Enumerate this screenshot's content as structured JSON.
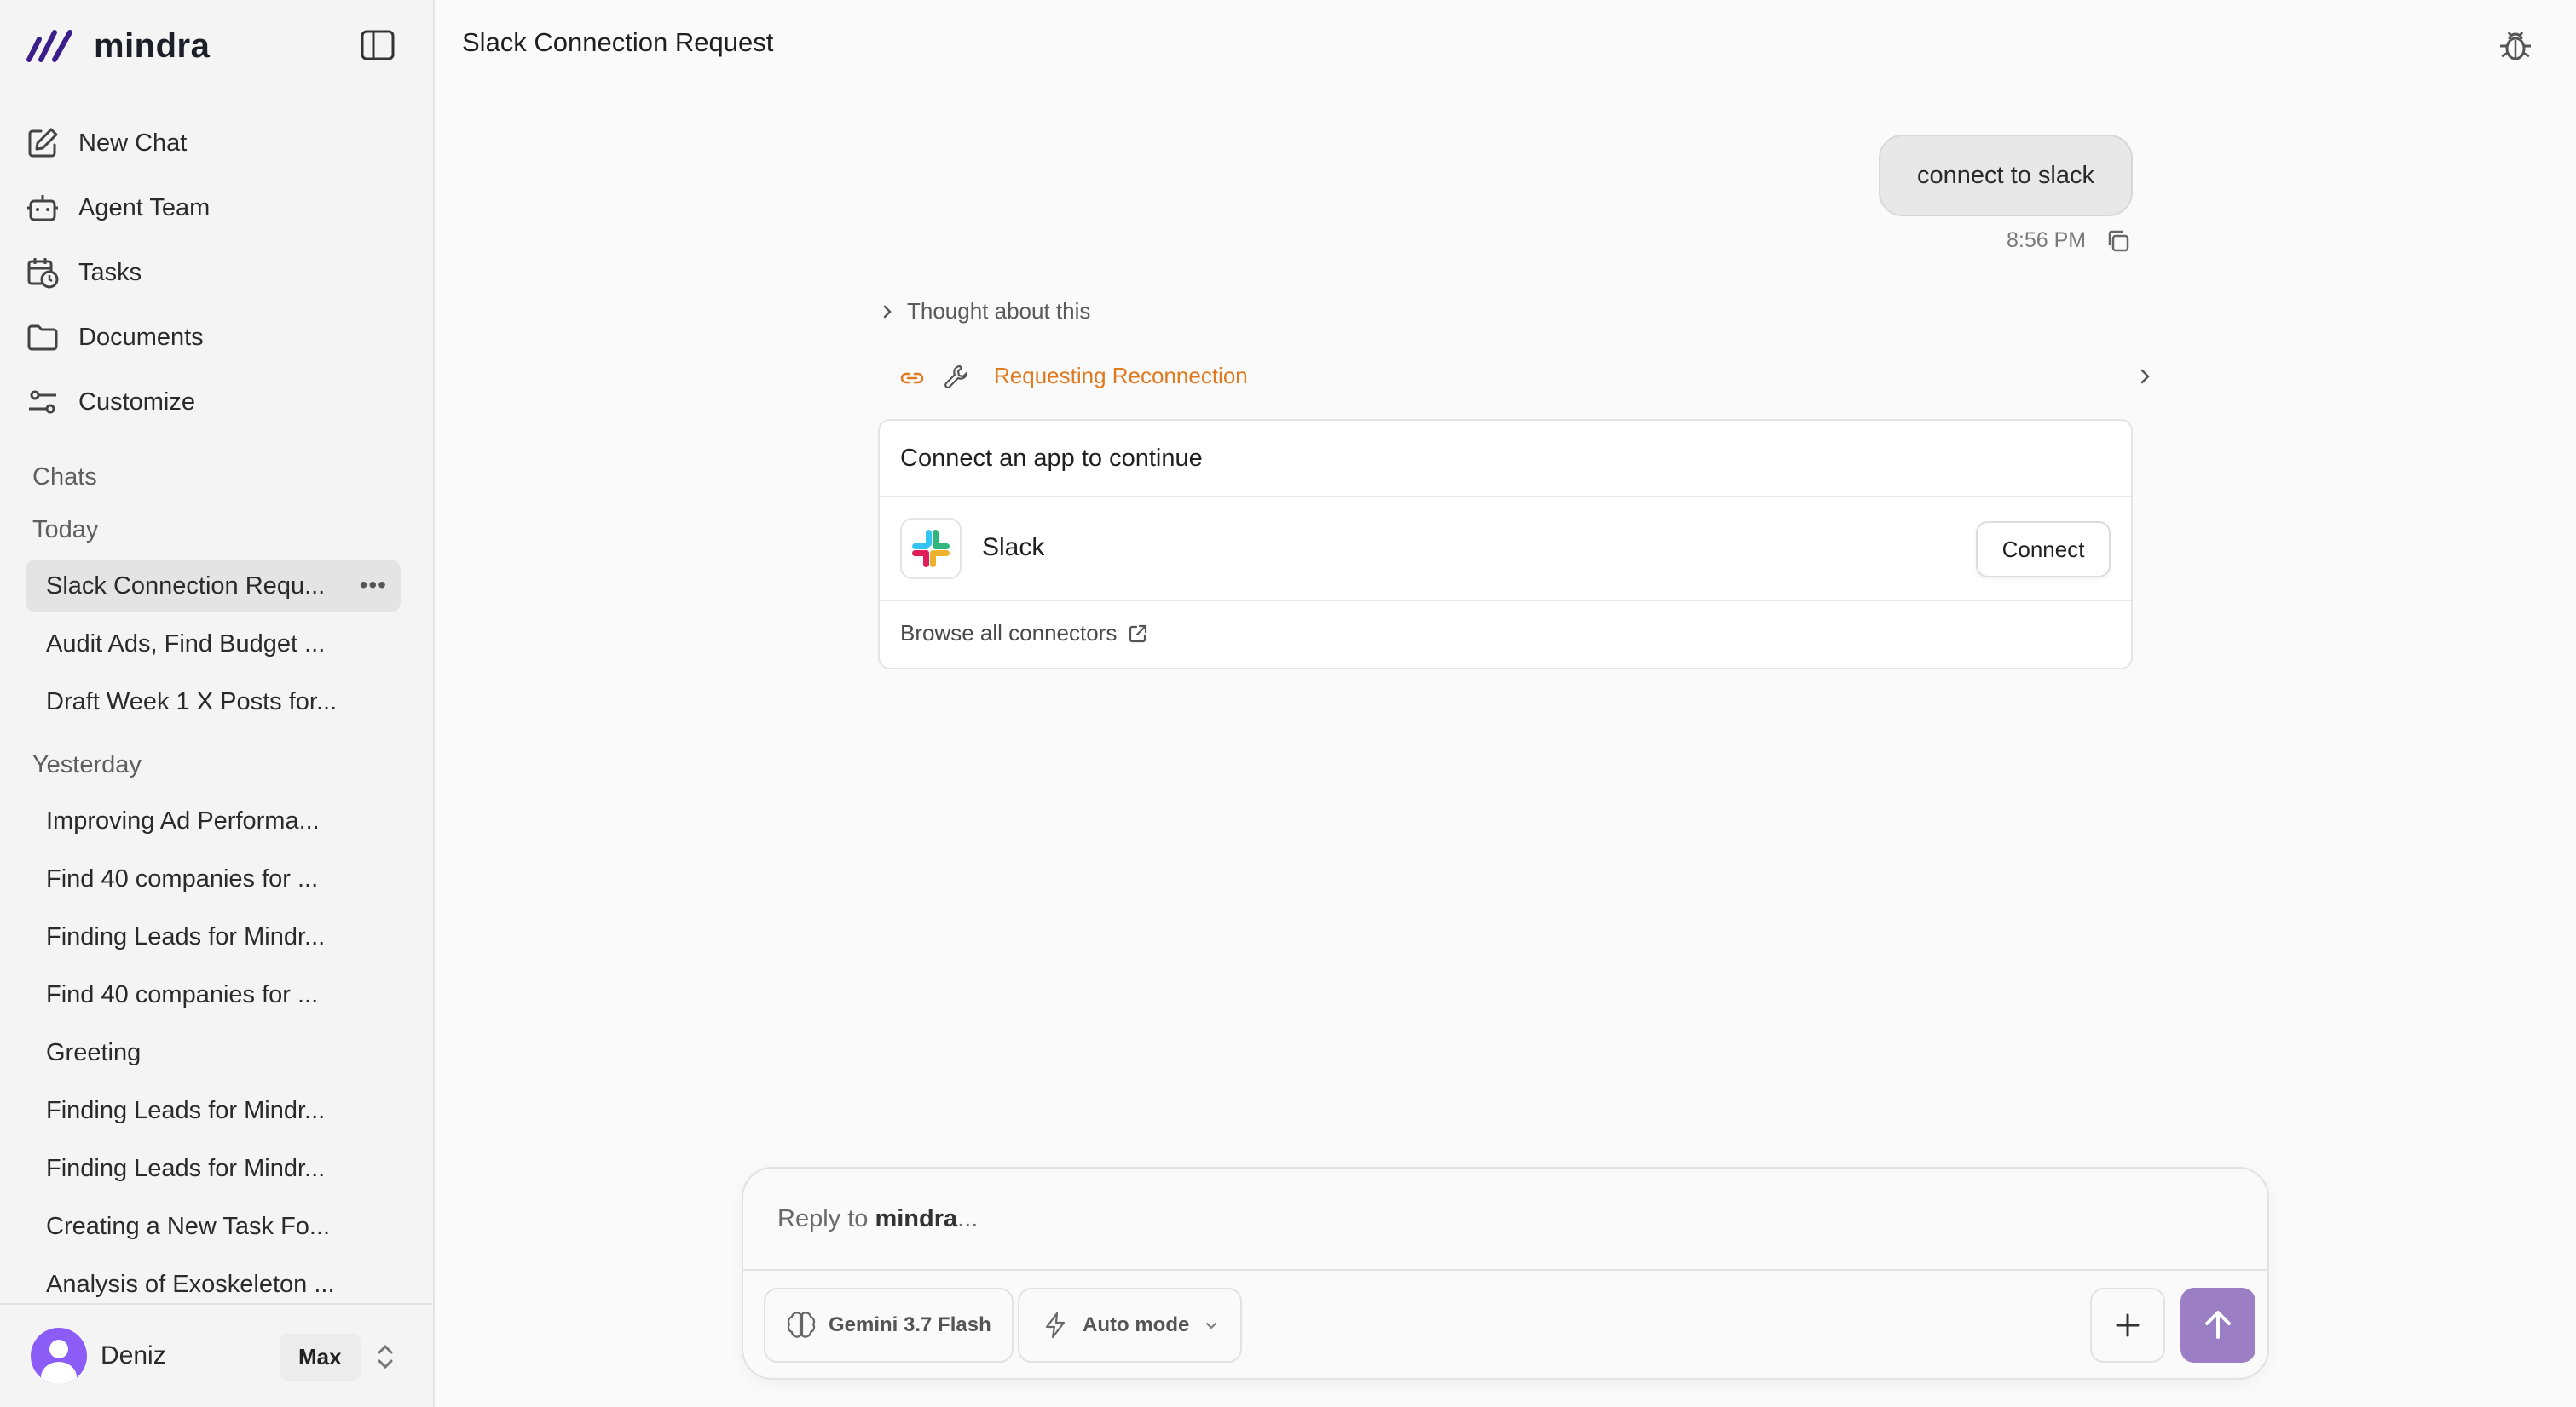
{
  "brand": {
    "name": "mindra"
  },
  "nav": [
    {
      "label": "New Chat",
      "icon": "edit-icon"
    },
    {
      "label": "Agent Team",
      "icon": "robot-icon"
    },
    {
      "label": "Tasks",
      "icon": "calendar-clock-icon"
    },
    {
      "label": "Documents",
      "icon": "folder-icon"
    },
    {
      "label": "Customize",
      "icon": "sliders-icon"
    }
  ],
  "sections": {
    "chats": "Chats",
    "today": "Today",
    "yesterday": "Yesterday"
  },
  "today_chats": [
    "Slack Connection Requ...",
    "Audit Ads, Find Budget ...",
    "Draft Week 1 X Posts for..."
  ],
  "yesterday_chats": [
    "Improving Ad Performa...",
    "Find 40 companies for ...",
    "Finding Leads for Mindr...",
    "Find 40 companies for ...",
    "Greeting",
    "Finding Leads for Mindr...",
    "Finding Leads for Mindr...",
    "Creating a New Task Fo...",
    "Analysis of Exoskeleton ..."
  ],
  "user": {
    "name": "Deniz",
    "plan": "Max"
  },
  "header": {
    "title": "Slack Connection Request"
  },
  "conversation": {
    "user_message": "connect to slack",
    "time": "8:56 PM",
    "thought_label": "Thought about this",
    "tool_label": "Requesting Reconnection",
    "card": {
      "title": "Connect an app to continue",
      "app_name": "Slack",
      "connect_label": "Connect",
      "browse_label": "Browse all connectors"
    }
  },
  "composer": {
    "placeholder_prefix": "Reply to ",
    "placeholder_brand": "mindra",
    "placeholder_suffix": "...",
    "model": "Gemini 3.7 Flash",
    "mode": "Auto mode"
  },
  "colors": {
    "accent": "#9b7ec4",
    "avatar": "#8b5cf6",
    "tool": "#e07a1f",
    "brand_logo": "#3b1e8a"
  }
}
